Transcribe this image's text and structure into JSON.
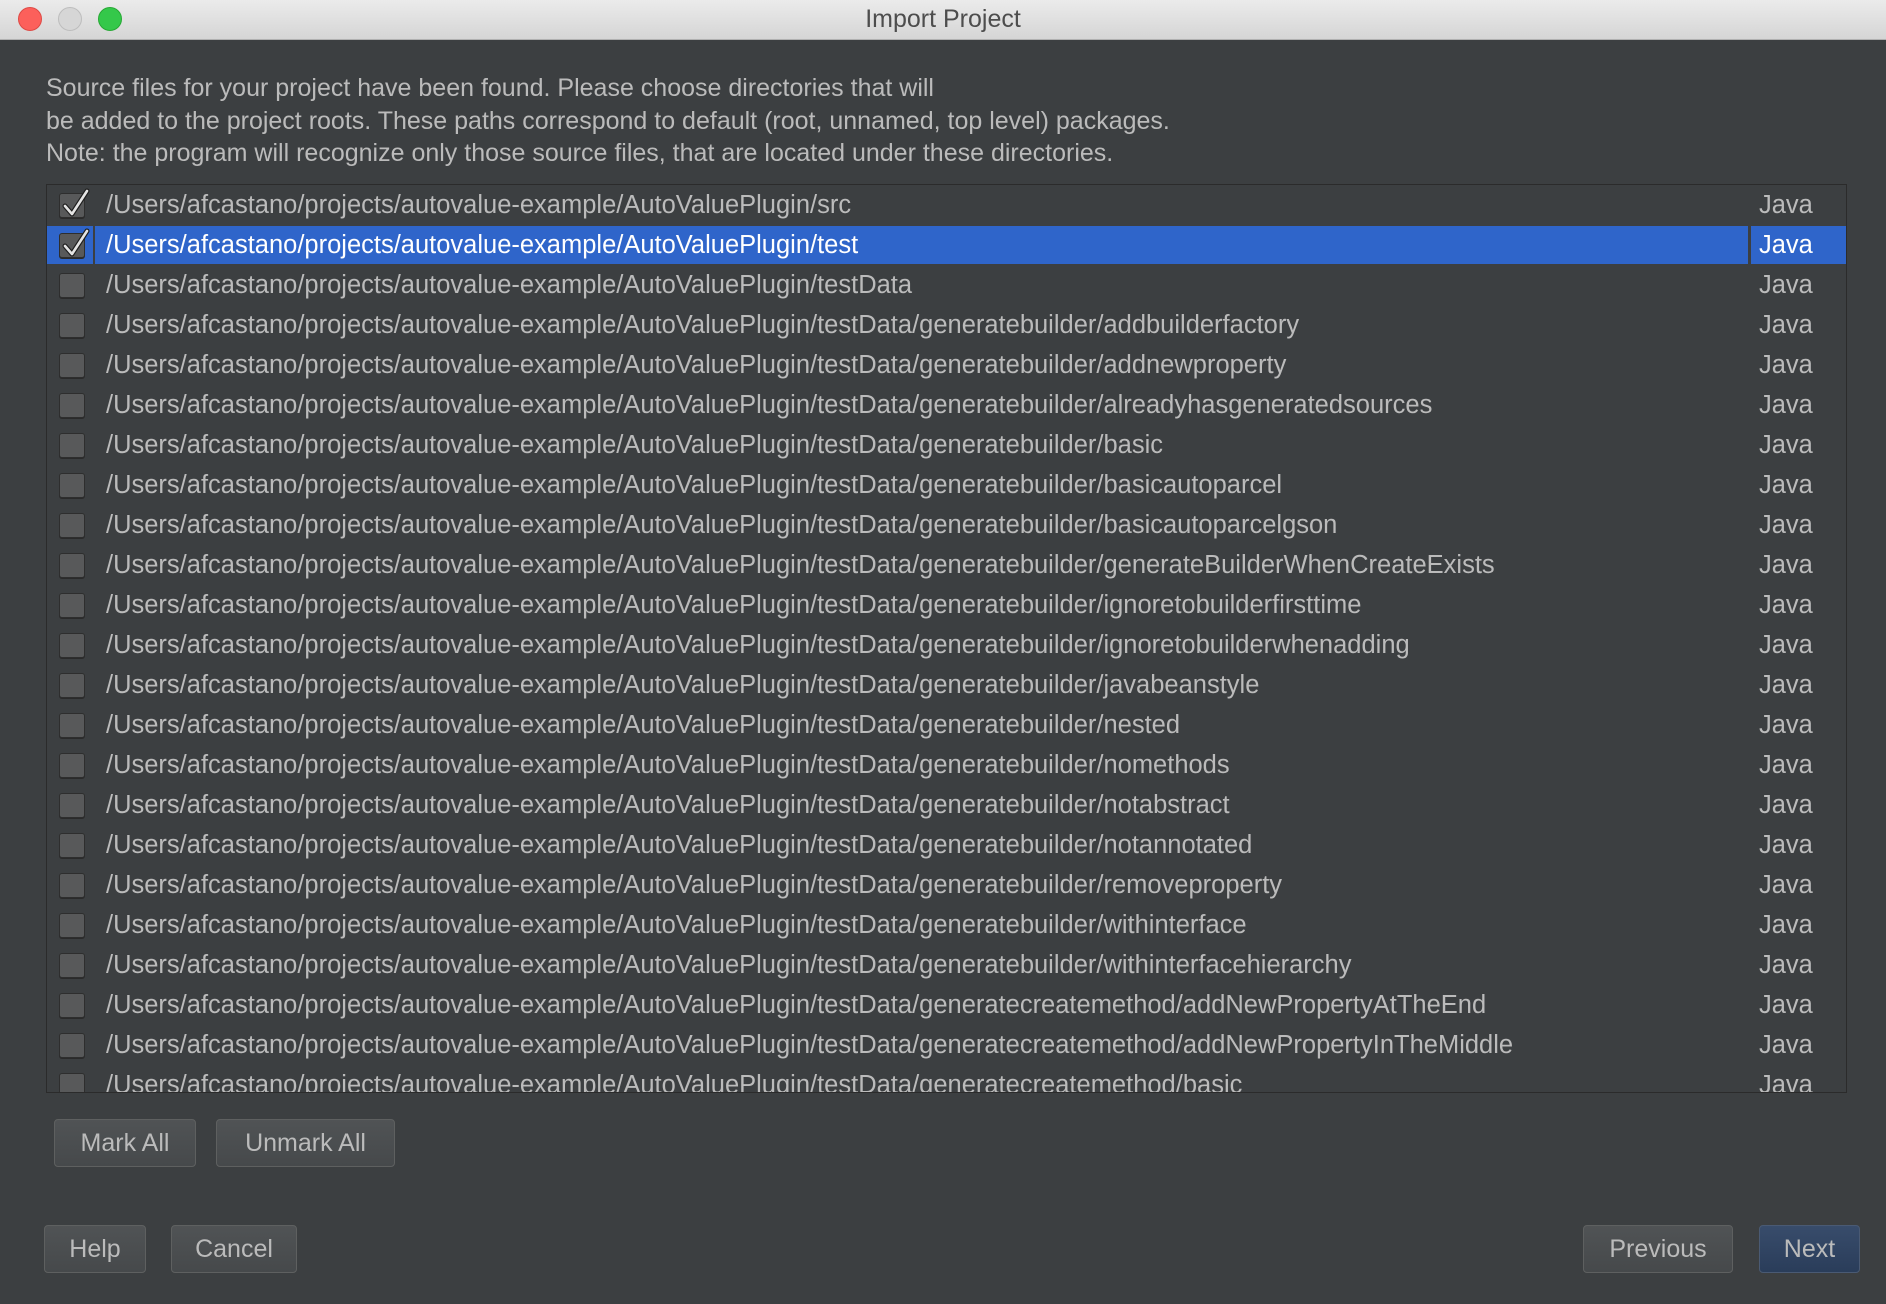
{
  "window": {
    "title": "Import Project"
  },
  "description": [
    "Source files for your project have been found. Please choose directories that will",
    "be added to the project roots. These paths correspond to default (root, unnamed, top level) packages.",
    "Note: the program will recognize only those source files, that are located under these directories."
  ],
  "colors": {
    "selection": "#2f65ca",
    "background": "#3c3f41",
    "text": "#bbbbbb",
    "default_button": "#2f4463"
  },
  "roots": [
    {
      "path": "/Users/afcastano/projects/autovalue-example/AutoValuePlugin/src",
      "type": "Java",
      "checked": true,
      "selected": false
    },
    {
      "path": "/Users/afcastano/projects/autovalue-example/AutoValuePlugin/test",
      "type": "Java",
      "checked": true,
      "selected": true
    },
    {
      "path": "/Users/afcastano/projects/autovalue-example/AutoValuePlugin/testData",
      "type": "Java",
      "checked": false,
      "selected": false
    },
    {
      "path": "/Users/afcastano/projects/autovalue-example/AutoValuePlugin/testData/generatebuilder/addbuilderfactory",
      "type": "Java",
      "checked": false,
      "selected": false
    },
    {
      "path": "/Users/afcastano/projects/autovalue-example/AutoValuePlugin/testData/generatebuilder/addnewproperty",
      "type": "Java",
      "checked": false,
      "selected": false
    },
    {
      "path": "/Users/afcastano/projects/autovalue-example/AutoValuePlugin/testData/generatebuilder/alreadyhasgeneratedsources",
      "type": "Java",
      "checked": false,
      "selected": false
    },
    {
      "path": "/Users/afcastano/projects/autovalue-example/AutoValuePlugin/testData/generatebuilder/basic",
      "type": "Java",
      "checked": false,
      "selected": false
    },
    {
      "path": "/Users/afcastano/projects/autovalue-example/AutoValuePlugin/testData/generatebuilder/basicautoparcel",
      "type": "Java",
      "checked": false,
      "selected": false
    },
    {
      "path": "/Users/afcastano/projects/autovalue-example/AutoValuePlugin/testData/generatebuilder/basicautoparcelgson",
      "type": "Java",
      "checked": false,
      "selected": false
    },
    {
      "path": "/Users/afcastano/projects/autovalue-example/AutoValuePlugin/testData/generatebuilder/generateBuilderWhenCreateExists",
      "type": "Java",
      "checked": false,
      "selected": false
    },
    {
      "path": "/Users/afcastano/projects/autovalue-example/AutoValuePlugin/testData/generatebuilder/ignoretobuilderfirsttime",
      "type": "Java",
      "checked": false,
      "selected": false
    },
    {
      "path": "/Users/afcastano/projects/autovalue-example/AutoValuePlugin/testData/generatebuilder/ignoretobuilderwhenadding",
      "type": "Java",
      "checked": false,
      "selected": false
    },
    {
      "path": "/Users/afcastano/projects/autovalue-example/AutoValuePlugin/testData/generatebuilder/javabeanstyle",
      "type": "Java",
      "checked": false,
      "selected": false
    },
    {
      "path": "/Users/afcastano/projects/autovalue-example/AutoValuePlugin/testData/generatebuilder/nested",
      "type": "Java",
      "checked": false,
      "selected": false
    },
    {
      "path": "/Users/afcastano/projects/autovalue-example/AutoValuePlugin/testData/generatebuilder/nomethods",
      "type": "Java",
      "checked": false,
      "selected": false
    },
    {
      "path": "/Users/afcastano/projects/autovalue-example/AutoValuePlugin/testData/generatebuilder/notabstract",
      "type": "Java",
      "checked": false,
      "selected": false
    },
    {
      "path": "/Users/afcastano/projects/autovalue-example/AutoValuePlugin/testData/generatebuilder/notannotated",
      "type": "Java",
      "checked": false,
      "selected": false
    },
    {
      "path": "/Users/afcastano/projects/autovalue-example/AutoValuePlugin/testData/generatebuilder/removeproperty",
      "type": "Java",
      "checked": false,
      "selected": false
    },
    {
      "path": "/Users/afcastano/projects/autovalue-example/AutoValuePlugin/testData/generatebuilder/withinterface",
      "type": "Java",
      "checked": false,
      "selected": false
    },
    {
      "path": "/Users/afcastano/projects/autovalue-example/AutoValuePlugin/testData/generatebuilder/withinterfacehierarchy",
      "type": "Java",
      "checked": false,
      "selected": false
    },
    {
      "path": "/Users/afcastano/projects/autovalue-example/AutoValuePlugin/testData/generatecreatemethod/addNewPropertyAtTheEnd",
      "type": "Java",
      "checked": false,
      "selected": false
    },
    {
      "path": "/Users/afcastano/projects/autovalue-example/AutoValuePlugin/testData/generatecreatemethod/addNewPropertyInTheMiddle",
      "type": "Java",
      "checked": false,
      "selected": false
    },
    {
      "path": "/Users/afcastano/projects/autovalue-example/AutoValuePlugin/testData/generatecreatemethod/basic",
      "type": "Java",
      "checked": false,
      "selected": false
    }
  ],
  "buttons": {
    "mark_all": "Mark All",
    "unmark_all": "Unmark All",
    "help": "Help",
    "cancel": "Cancel",
    "previous": "Previous",
    "next": "Next"
  }
}
